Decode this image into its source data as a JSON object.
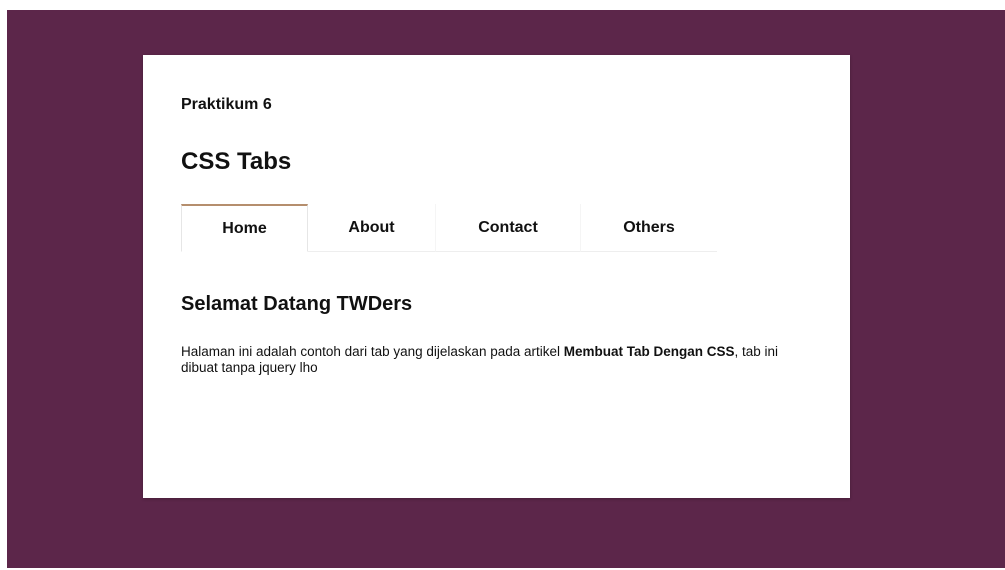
{
  "page": {
    "subtitle": "Praktikum 6",
    "title": "CSS Tabs"
  },
  "tabs": [
    {
      "label": "Home",
      "active": true
    },
    {
      "label": "About",
      "active": false
    },
    {
      "label": "Contact",
      "active": false
    },
    {
      "label": "Others",
      "active": false
    }
  ],
  "content": {
    "heading": "Selamat Datang TWDers",
    "text_before": "Halaman ini adalah contoh dari tab yang dijelaskan pada artikel ",
    "article_link": "Membuat Tab Dengan CSS",
    "text_after": ", tab ini dibuat tanpa jquery lho"
  },
  "colors": {
    "background": "#5c264a",
    "card": "#ffffff",
    "active_tab_accent": "#b58e6d"
  }
}
